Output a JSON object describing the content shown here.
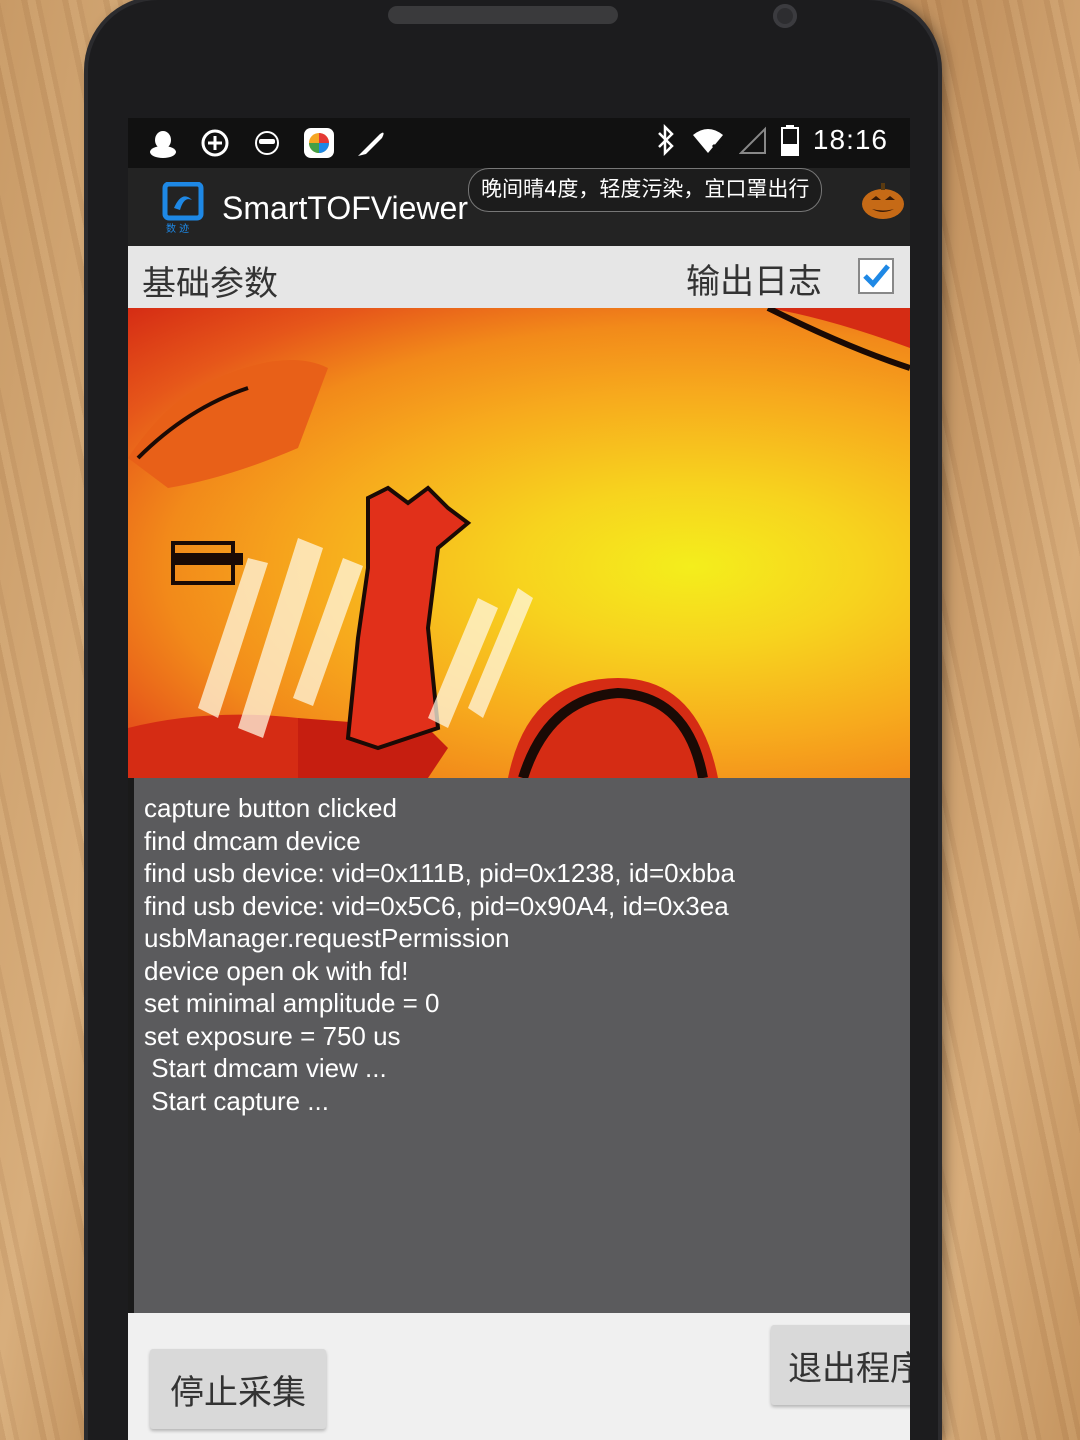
{
  "status_bar": {
    "left_icons": [
      "qq-penguin-icon",
      "add-circle-icon",
      "glasses-face-icon",
      "color-wheel-icon",
      "feather-icon"
    ],
    "right_icons": [
      "bluetooth-icon",
      "wifi-icon",
      "signal-icon",
      "battery-icon"
    ],
    "time": "18:16"
  },
  "action_bar": {
    "app_title": "SmartTOFViewer",
    "logo_caption": "数 迹",
    "weather_text": "晚间晴4度，轻度污染，宜口罩出行"
  },
  "header": {
    "basic_params": "基础参数",
    "log_output_label": "输出日志",
    "log_output_checked": true
  },
  "log": {
    "lines": [
      "capture button clicked",
      "find dmcam device",
      "find usb device: vid=0x111B, pid=0x1238, id=0xbba",
      "find usb device: vid=0x5C6, pid=0x90A4, id=0x3ea",
      "usbManager.requestPermission",
      "device open ok with fd!",
      "set minimal amplitude = 0",
      "set exposure = 750 us",
      " Start dmcam view ...",
      " Start capture ..."
    ]
  },
  "buttons": {
    "stop_capture": "停止采集",
    "exit_program": "退出程序"
  },
  "colors": {
    "accent_blue": "#1e88e5",
    "log_bg": "#5b5b5d",
    "depth_near": "#d52c14",
    "depth_far": "#f4ee1c"
  }
}
